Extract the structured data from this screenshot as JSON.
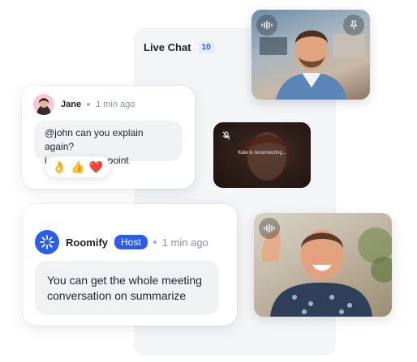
{
  "live_chat": {
    "title": "Live Chat",
    "count": "10"
  },
  "jane": {
    "name": "Jane",
    "time": "1 min ago",
    "mention": "@john",
    "line1": " can you explain again?",
    "line2": "i didn't get the point",
    "reactions": [
      "👌",
      "👍",
      "❤️"
    ]
  },
  "roomify": {
    "name": "Roomify",
    "badge": "Host",
    "time": "1 min ago",
    "line1": "You can get the whole meeting",
    "line2": "conversation on summarize"
  },
  "video2": {
    "status": "Kate is reconnecting..."
  },
  "colors": {
    "accent": "#2a5cf4",
    "badge_bg": "#e7edff",
    "bubble": "#f1f2f4"
  },
  "icons": [
    "audio-wave-icon",
    "pin-icon",
    "mic-off-icon",
    "roomify-logo-icon"
  ]
}
